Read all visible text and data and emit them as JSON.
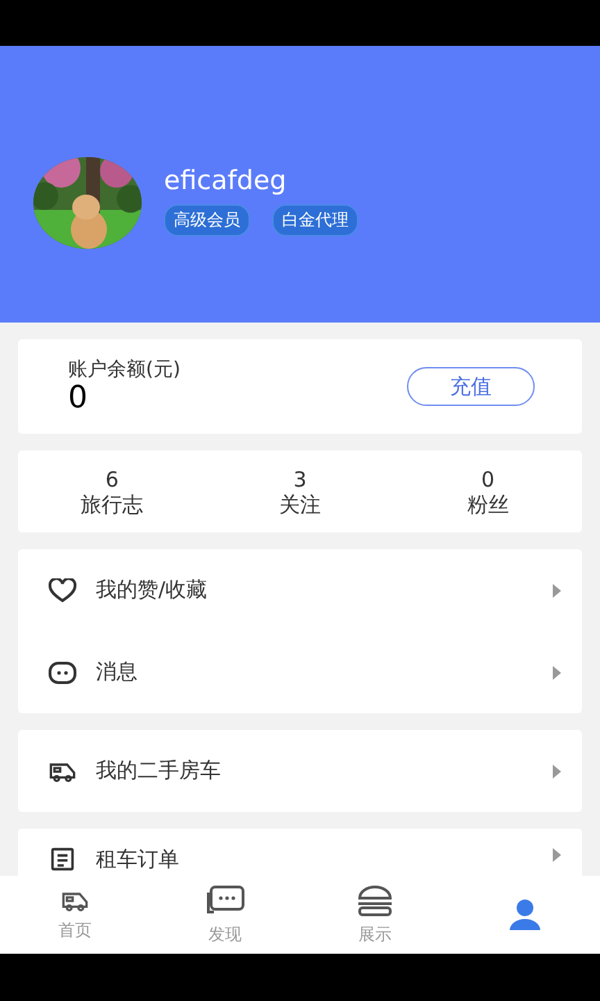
{
  "profile": {
    "username": "eficafdeg",
    "badges": [
      "高级会员",
      "白金代理"
    ],
    "avatar": {
      "kind": "picture"
    }
  },
  "balance": {
    "label": "账户余额(元)",
    "amount": "0",
    "button": "充值"
  },
  "stats": [
    {
      "value": "6",
      "label": "旅行志"
    },
    {
      "value": "3",
      "label": "关注"
    },
    {
      "value": "0",
      "label": "粉丝"
    }
  ],
  "menu_groups": [
    [
      "我的赞/收藏",
      "消息"
    ],
    [
      "我的二手房车"
    ],
    [
      "租车订单"
    ]
  ],
  "tab_bar": [
    {
      "label": "首页",
      "selected": false
    },
    {
      "label": "发现",
      "selected": false
    },
    {
      "label": "展示",
      "selected": false
    },
    {
      "selected": true
    }
  ]
}
